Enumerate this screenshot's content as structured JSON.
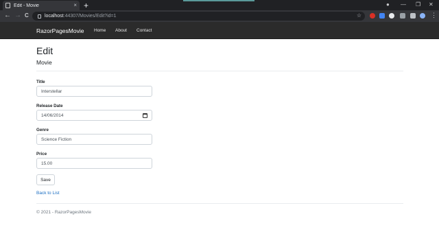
{
  "browser": {
    "tab_title": "Edit - Movie",
    "tab_close": "×",
    "new_tab": "+",
    "url_host": "localhost",
    "url_rest": ":44307/Movies/Edit?id=1",
    "back": "←",
    "forward": "→",
    "reload": "C",
    "star": "☆",
    "menu": "⋮",
    "minimize": "—",
    "restore": "❐",
    "close": "✕"
  },
  "navbar": {
    "brand": "RazorPagesMovie",
    "links": [
      "Home",
      "About",
      "Contact"
    ]
  },
  "page": {
    "title": "Edit",
    "subtitle": "Movie"
  },
  "form": {
    "title_label": "Title",
    "title_value": "Interstellar",
    "release_label": "Release Date",
    "release_value": "14/06/2014",
    "genre_label": "Genre",
    "genre_value": "Science Fiction",
    "price_label": "Price",
    "price_value": "15.00",
    "save_label": "Save"
  },
  "back_link": "Back to List",
  "footer": "© 2021 - RazorPagesMovie",
  "colors": {
    "link": "#1b6ec2",
    "navbar": "#2b2b2b",
    "chrome_dark": "#202124"
  }
}
